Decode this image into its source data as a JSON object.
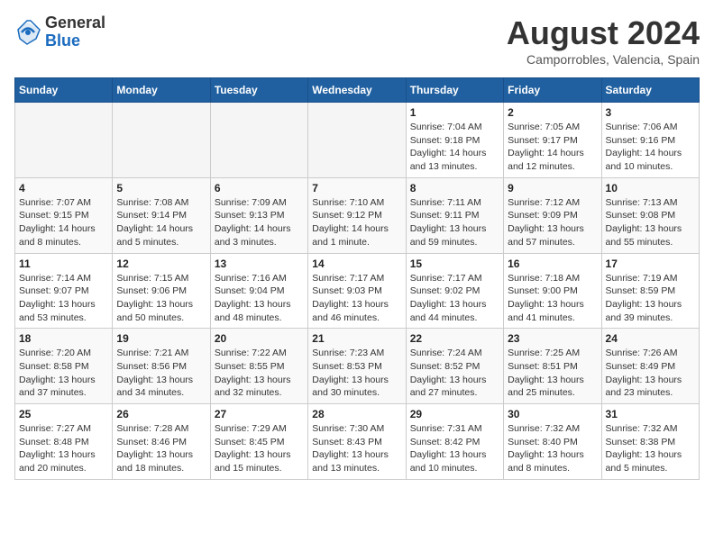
{
  "header": {
    "logo_line1": "General",
    "logo_line2": "Blue",
    "month_year": "August 2024",
    "location": "Camporrobles, Valencia, Spain"
  },
  "weekdays": [
    "Sunday",
    "Monday",
    "Tuesday",
    "Wednesday",
    "Thursday",
    "Friday",
    "Saturday"
  ],
  "weeks": [
    [
      {
        "day": "",
        "info": ""
      },
      {
        "day": "",
        "info": ""
      },
      {
        "day": "",
        "info": ""
      },
      {
        "day": "",
        "info": ""
      },
      {
        "day": "1",
        "info": "Sunrise: 7:04 AM\nSunset: 9:18 PM\nDaylight: 14 hours\nand 13 minutes."
      },
      {
        "day": "2",
        "info": "Sunrise: 7:05 AM\nSunset: 9:17 PM\nDaylight: 14 hours\nand 12 minutes."
      },
      {
        "day": "3",
        "info": "Sunrise: 7:06 AM\nSunset: 9:16 PM\nDaylight: 14 hours\nand 10 minutes."
      }
    ],
    [
      {
        "day": "4",
        "info": "Sunrise: 7:07 AM\nSunset: 9:15 PM\nDaylight: 14 hours\nand 8 minutes."
      },
      {
        "day": "5",
        "info": "Sunrise: 7:08 AM\nSunset: 9:14 PM\nDaylight: 14 hours\nand 5 minutes."
      },
      {
        "day": "6",
        "info": "Sunrise: 7:09 AM\nSunset: 9:13 PM\nDaylight: 14 hours\nand 3 minutes."
      },
      {
        "day": "7",
        "info": "Sunrise: 7:10 AM\nSunset: 9:12 PM\nDaylight: 14 hours\nand 1 minute."
      },
      {
        "day": "8",
        "info": "Sunrise: 7:11 AM\nSunset: 9:11 PM\nDaylight: 13 hours\nand 59 minutes."
      },
      {
        "day": "9",
        "info": "Sunrise: 7:12 AM\nSunset: 9:09 PM\nDaylight: 13 hours\nand 57 minutes."
      },
      {
        "day": "10",
        "info": "Sunrise: 7:13 AM\nSunset: 9:08 PM\nDaylight: 13 hours\nand 55 minutes."
      }
    ],
    [
      {
        "day": "11",
        "info": "Sunrise: 7:14 AM\nSunset: 9:07 PM\nDaylight: 13 hours\nand 53 minutes."
      },
      {
        "day": "12",
        "info": "Sunrise: 7:15 AM\nSunset: 9:06 PM\nDaylight: 13 hours\nand 50 minutes."
      },
      {
        "day": "13",
        "info": "Sunrise: 7:16 AM\nSunset: 9:04 PM\nDaylight: 13 hours\nand 48 minutes."
      },
      {
        "day": "14",
        "info": "Sunrise: 7:17 AM\nSunset: 9:03 PM\nDaylight: 13 hours\nand 46 minutes."
      },
      {
        "day": "15",
        "info": "Sunrise: 7:17 AM\nSunset: 9:02 PM\nDaylight: 13 hours\nand 44 minutes."
      },
      {
        "day": "16",
        "info": "Sunrise: 7:18 AM\nSunset: 9:00 PM\nDaylight: 13 hours\nand 41 minutes."
      },
      {
        "day": "17",
        "info": "Sunrise: 7:19 AM\nSunset: 8:59 PM\nDaylight: 13 hours\nand 39 minutes."
      }
    ],
    [
      {
        "day": "18",
        "info": "Sunrise: 7:20 AM\nSunset: 8:58 PM\nDaylight: 13 hours\nand 37 minutes."
      },
      {
        "day": "19",
        "info": "Sunrise: 7:21 AM\nSunset: 8:56 PM\nDaylight: 13 hours\nand 34 minutes."
      },
      {
        "day": "20",
        "info": "Sunrise: 7:22 AM\nSunset: 8:55 PM\nDaylight: 13 hours\nand 32 minutes."
      },
      {
        "day": "21",
        "info": "Sunrise: 7:23 AM\nSunset: 8:53 PM\nDaylight: 13 hours\nand 30 minutes."
      },
      {
        "day": "22",
        "info": "Sunrise: 7:24 AM\nSunset: 8:52 PM\nDaylight: 13 hours\nand 27 minutes."
      },
      {
        "day": "23",
        "info": "Sunrise: 7:25 AM\nSunset: 8:51 PM\nDaylight: 13 hours\nand 25 minutes."
      },
      {
        "day": "24",
        "info": "Sunrise: 7:26 AM\nSunset: 8:49 PM\nDaylight: 13 hours\nand 23 minutes."
      }
    ],
    [
      {
        "day": "25",
        "info": "Sunrise: 7:27 AM\nSunset: 8:48 PM\nDaylight: 13 hours\nand 20 minutes."
      },
      {
        "day": "26",
        "info": "Sunrise: 7:28 AM\nSunset: 8:46 PM\nDaylight: 13 hours\nand 18 minutes."
      },
      {
        "day": "27",
        "info": "Sunrise: 7:29 AM\nSunset: 8:45 PM\nDaylight: 13 hours\nand 15 minutes."
      },
      {
        "day": "28",
        "info": "Sunrise: 7:30 AM\nSunset: 8:43 PM\nDaylight: 13 hours\nand 13 minutes."
      },
      {
        "day": "29",
        "info": "Sunrise: 7:31 AM\nSunset: 8:42 PM\nDaylight: 13 hours\nand 10 minutes."
      },
      {
        "day": "30",
        "info": "Sunrise: 7:32 AM\nSunset: 8:40 PM\nDaylight: 13 hours\nand 8 minutes."
      },
      {
        "day": "31",
        "info": "Sunrise: 7:32 AM\nSunset: 8:38 PM\nDaylight: 13 hours\nand 5 minutes."
      }
    ]
  ]
}
